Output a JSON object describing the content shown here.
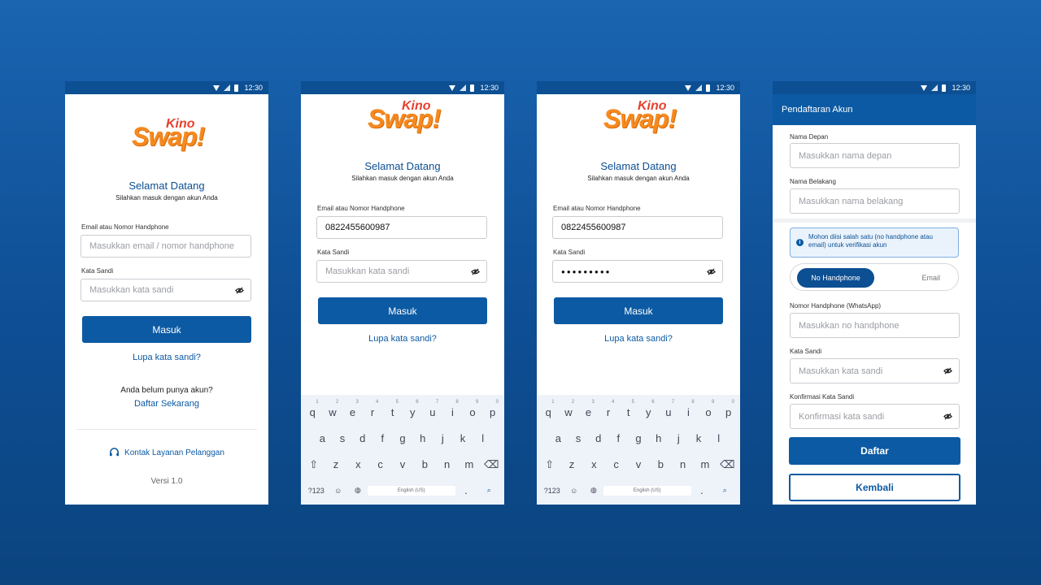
{
  "status_time": "12:30",
  "brand": {
    "kino": "Kino",
    "swap": "Swap!"
  },
  "login": {
    "welcome": "Selamat Datang",
    "subtitle": "Silahkan masuk dengan akun Anda",
    "email_label": "Email atau Nomor Handphone",
    "email_placeholder": "Masukkan email / nomor handphone",
    "password_label": "Kata Sandi",
    "password_placeholder": "Masukkan kata sandi",
    "email_value": "0822455600987",
    "password_value": "●●●●●●●●●",
    "submit": "Masuk",
    "forgot": "Lupa kata sandi?",
    "no_account": "Anda belum punya akun?",
    "register_now": "Daftar Sekarang",
    "contact": "Kontak Layanan Pelanggan",
    "version": "Versi 1.0"
  },
  "keyboard": {
    "row1": [
      "q",
      "w",
      "e",
      "r",
      "t",
      "y",
      "u",
      "i",
      "o",
      "p"
    ],
    "row1_hints": [
      "1",
      "2",
      "3",
      "4",
      "5",
      "6",
      "7",
      "8",
      "9",
      "0"
    ],
    "row2": [
      "a",
      "s",
      "d",
      "f",
      "g",
      "h",
      "j",
      "k",
      "l"
    ],
    "row3": [
      "z",
      "x",
      "c",
      "v",
      "b",
      "n",
      "m"
    ],
    "symbols": "?123",
    "space": "English (US)",
    "period": "."
  },
  "register": {
    "title": "Pendaftaran Akun",
    "first_name_label": "Nama Depan",
    "first_name_placeholder": "Masukkan nama depan",
    "last_name_label": "Nama Belakang",
    "last_name_placeholder": "Masukkan nama belakang",
    "info": "Mohon diisi salah satu (no handphone atau email) untuk verifikasi akun",
    "tab_phone": "No Handphone",
    "tab_email": "Email",
    "phone_label": "Nomor Handphone (WhatsApp)",
    "phone_placeholder": "Masukkan no handphone",
    "password_label": "Kata Sandi",
    "password_placeholder": "Masukkan kata sandi",
    "confirm_label": "Konfirmasi Kata Sandi",
    "confirm_placeholder": "Konfirmasi kata sandi",
    "submit": "Daftar",
    "back": "Kembali"
  }
}
